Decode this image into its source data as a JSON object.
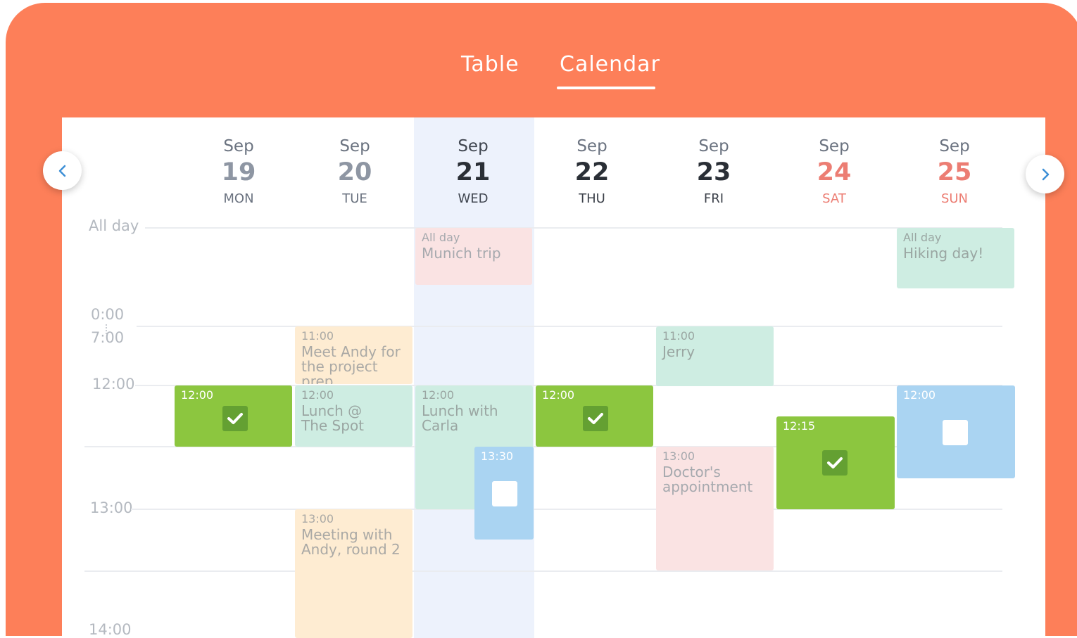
{
  "tabs": {
    "table": "Table",
    "calendar": "Calendar",
    "active": "Calendar"
  },
  "colors": {
    "brand": "#fd7f59",
    "today_column": "#edf2fc",
    "weekend": "#ec7d73",
    "done_green": "#8cc63f",
    "todo_blue": "#aad4f2"
  },
  "nav": {
    "prev_icon": "chevron-left-icon",
    "next_icon": "chevron-right-icon"
  },
  "days": [
    {
      "month": "Sep",
      "date": "19",
      "weekday": "MON"
    },
    {
      "month": "Sep",
      "date": "20",
      "weekday": "TUE"
    },
    {
      "month": "Sep",
      "date": "21",
      "weekday": "WED"
    },
    {
      "month": "Sep",
      "date": "22",
      "weekday": "THU"
    },
    {
      "month": "Sep",
      "date": "23",
      "weekday": "FRI"
    },
    {
      "month": "Sep",
      "date": "24",
      "weekday": "SAT"
    },
    {
      "month": "Sep",
      "date": "25",
      "weekday": "SUN"
    }
  ],
  "time_labels": {
    "all_day": "All day",
    "t0000": "0:00",
    "t0700": "7:00",
    "t1200": "12:00",
    "t1300": "13:00",
    "t1400": "14:00"
  },
  "events": {
    "munich": {
      "time": "All day",
      "title": "Munich trip"
    },
    "hiking": {
      "time": "All day",
      "title": "Hiking day!"
    },
    "meet_andy": {
      "time": "11:00",
      "title": "Meet Andy for the project prep"
    },
    "jerry": {
      "time": "11:00",
      "title": "Jerry"
    },
    "mon_task": {
      "time": "12:00",
      "status": "done",
      "icon": "checkmark-icon"
    },
    "lunch_spot": {
      "time": "12:00",
      "title": "Lunch @ The Spot"
    },
    "lunch_carla": {
      "time": "12:00",
      "title": "Lunch with Carla"
    },
    "thu_task": {
      "time": "12:00",
      "status": "done",
      "icon": "checkmark-icon"
    },
    "sun_task": {
      "time": "12:00",
      "status": "todo",
      "icon": "empty-checkbox-icon"
    },
    "sat_task": {
      "time": "12:15",
      "status": "done",
      "icon": "checkmark-icon"
    },
    "wed_task": {
      "time": "13:30",
      "status": "todo",
      "icon": "empty-checkbox-icon"
    },
    "doctor": {
      "time": "13:00",
      "title": "Doctor's appointment"
    },
    "meeting_andy2": {
      "time": "13:00",
      "title": "Meeting with Andy, round 2"
    }
  }
}
